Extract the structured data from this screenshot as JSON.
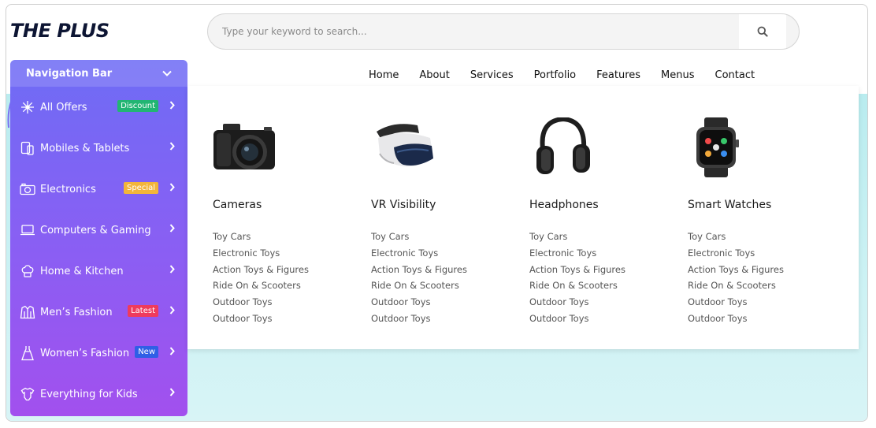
{
  "logo": {
    "text": "THE PLUS"
  },
  "search": {
    "placeholder": "Type your keyword to search..."
  },
  "topnav": [
    "Home",
    "About",
    "Services",
    "Portfolio",
    "Features",
    "Menus",
    "Contact"
  ],
  "sidebar": {
    "title": "Navigation Bar",
    "items": [
      {
        "label": "All Offers",
        "icon": "snowflake-icon",
        "badge": "Discount",
        "badge_color": "#22b573"
      },
      {
        "label": "Mobiles & Tablets",
        "icon": "mobile-tablet-icon",
        "badge": "",
        "badge_color": ""
      },
      {
        "label": "Electronics",
        "icon": "camera-icon",
        "badge": "Special",
        "badge_color": "#f2b53a"
      },
      {
        "label": "Computers & Gaming",
        "icon": "laptop-icon",
        "badge": "",
        "badge_color": ""
      },
      {
        "label": "Home & Kitchen",
        "icon": "chef-hat-icon",
        "badge": "",
        "badge_color": ""
      },
      {
        "label": "Men’s Fashion",
        "icon": "jacket-icon",
        "badge": "Latest",
        "badge_color": "#ef3b5d"
      },
      {
        "label": "Women’s Fashion",
        "icon": "dress-icon",
        "badge": "New",
        "badge_color": "#2f5fe6"
      },
      {
        "label": "Everything for Kids",
        "icon": "onesie-icon",
        "badge": "",
        "badge_color": ""
      }
    ]
  },
  "mega_menu": {
    "columns": [
      {
        "title": "Cameras",
        "image": "camera-image",
        "links": [
          "Toy Cars",
          "Electronic Toys",
          "Action Toys & Figures",
          "Ride On & Scooters",
          "Outdoor Toys",
          "Outdoor Toys"
        ]
      },
      {
        "title": "VR Visibility",
        "image": "vr-headset-image",
        "links": [
          "Toy Cars",
          "Electronic Toys",
          "Action Toys & Figures",
          "Ride On & Scooters",
          "Outdoor Toys",
          "Outdoor Toys"
        ]
      },
      {
        "title": "Headphones",
        "image": "headphones-image",
        "links": [
          "Toy Cars",
          "Electronic Toys",
          "Action Toys & Figures",
          "Ride On & Scooters",
          "Outdoor Toys",
          "Outdoor Toys"
        ]
      },
      {
        "title": "Smart Watches",
        "image": "smartwatch-image",
        "links": [
          "Toy Cars",
          "Electronic Toys",
          "Action Toys & Figures",
          "Ride On & Scooters",
          "Outdoor Toys",
          "Outdoor Toys"
        ]
      }
    ]
  },
  "colors": {
    "sidebar_top": "#6e6cf5",
    "sidebar_bottom": "#a250ee",
    "background": "#c4eff2",
    "logo": "#0d1533"
  }
}
